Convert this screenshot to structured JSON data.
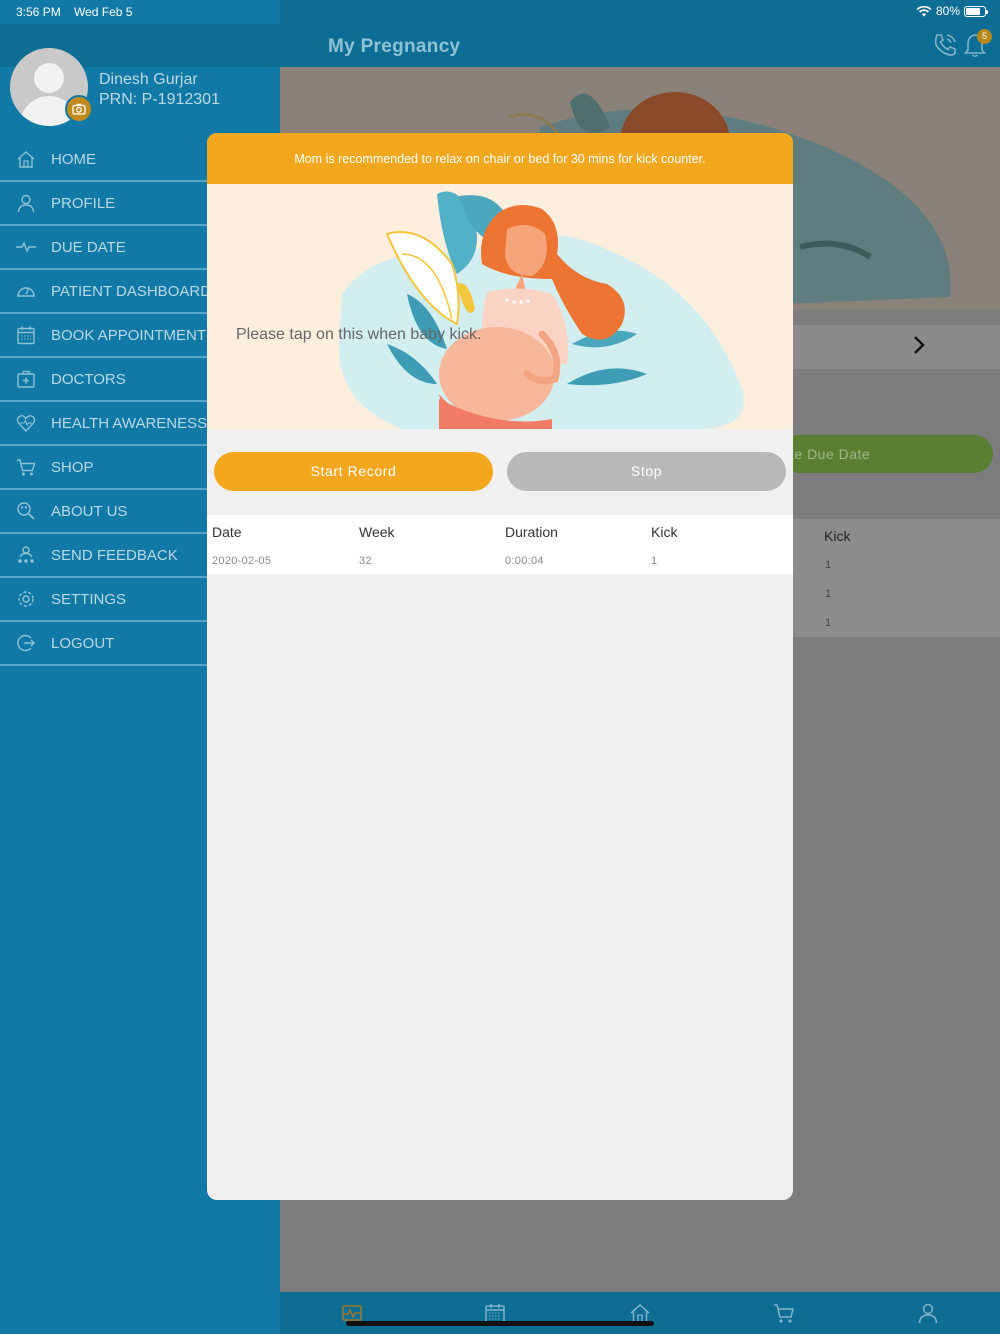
{
  "status_bar": {
    "time": "3:56 PM",
    "date": "Wed Feb 5",
    "battery": "80%"
  },
  "header": {
    "title": "My Pregnancy",
    "notification_count": "5"
  },
  "user": {
    "name": "Dinesh Gurjar",
    "prn": "PRN: P-1912301"
  },
  "menu": {
    "items": [
      {
        "label": "HOME",
        "icon": "home-icon"
      },
      {
        "label": "PROFILE",
        "icon": "person-icon"
      },
      {
        "label": "DUE DATE",
        "icon": "pulse-icon"
      },
      {
        "label": "PATIENT DASHBOARD",
        "icon": "gauge-icon"
      },
      {
        "label": "BOOK APPOINTMENT",
        "icon": "calendar-icon"
      },
      {
        "label": "DOCTORS",
        "icon": "medical-kit-icon"
      },
      {
        "label": "HEALTH AWARENESS",
        "icon": "heart-icon"
      },
      {
        "label": "SHOP",
        "icon": "cart-icon"
      },
      {
        "label": "ABOUT US",
        "icon": "search-people-icon"
      },
      {
        "label": "SEND FEEDBACK",
        "icon": "feedback-icon"
      },
      {
        "label": "SETTINGS",
        "icon": "gear-icon"
      },
      {
        "label": "LOGOUT",
        "icon": "logout-icon"
      }
    ]
  },
  "background": {
    "calculate_button_label": "te Due Date",
    "table": {
      "kick_header": "Kick",
      "kick_values": [
        "1",
        "1",
        "1"
      ]
    }
  },
  "modal": {
    "banner": "Mom is recommended to relax on chair or bed for 30 mins for kick counter.",
    "tap_prompt": "Please tap on this when baby kick.",
    "start_label": "Start Record",
    "stop_label": "Stop",
    "table": {
      "headers": [
        "Date",
        "Week",
        "Duration",
        "Kick"
      ],
      "rows": [
        [
          "2020-02-05",
          "32",
          "0:00:04",
          "1"
        ]
      ]
    }
  },
  "colors": {
    "primary": "#1079a6",
    "header": "#0d6d94",
    "accent": "#f2a71c",
    "stop_button": "#b9b9b9",
    "calc_button": "#5a7f33"
  }
}
